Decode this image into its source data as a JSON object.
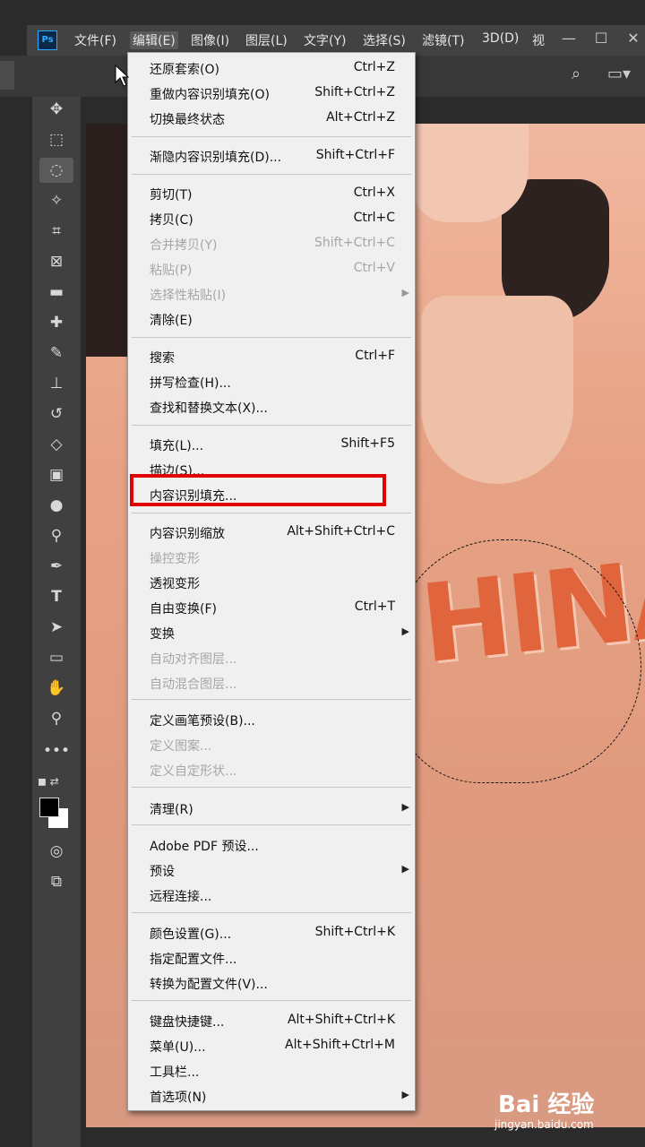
{
  "app": {
    "logo": "Ps"
  },
  "menubar": {
    "items": [
      "文件(F)",
      "编辑(E)",
      "图像(I)",
      "图层(L)",
      "文字(Y)",
      "选择(S)",
      "滤镜(T)",
      "3D(D)",
      "视"
    ],
    "active": "编辑(E)",
    "window_controls": [
      "minimize-icon",
      "maximize-icon",
      "close-icon"
    ]
  },
  "options_bar": {
    "icons": [
      "search-icon",
      "workspace-icon"
    ]
  },
  "toolbar": {
    "tools": [
      "move-icon",
      "marquee-icon",
      "lasso-icon",
      "magic-wand-icon",
      "crop-icon",
      "frame-icon",
      "ruler-icon",
      "healing-icon",
      "brush-icon",
      "stamp-icon",
      "history-brush-icon",
      "eraser-icon",
      "gradient-icon",
      "blur-icon",
      "dodge-icon",
      "pen-icon",
      "type-icon",
      "path-select-icon",
      "rectangle-icon",
      "hand-icon",
      "zoom-icon",
      "more-icon"
    ],
    "selected": "lasso-icon",
    "foreground": "#000000",
    "background": "#ffffff"
  },
  "edit_menu": {
    "items": [
      {
        "label": "还原套索(O)",
        "shortcut": "Ctrl+Z"
      },
      {
        "label": "重做内容识别填充(O)",
        "shortcut": "Shift+Ctrl+Z"
      },
      {
        "label": "切换最终状态",
        "shortcut": "Alt+Ctrl+Z"
      },
      {
        "label": "渐隐内容识别填充(D)...",
        "shortcut": "Shift+Ctrl+F"
      },
      {
        "label": "剪切(T)",
        "shortcut": "Ctrl+X"
      },
      {
        "label": "拷贝(C)",
        "shortcut": "Ctrl+C"
      },
      {
        "label": "合并拷贝(Y)",
        "shortcut": "Shift+Ctrl+C",
        "disabled": true
      },
      {
        "label": "粘贴(P)",
        "shortcut": "Ctrl+V",
        "disabled": true
      },
      {
        "label": "选择性粘贴(I)",
        "shortcut": "",
        "disabled": true,
        "submenu": true
      },
      {
        "label": "清除(E)",
        "shortcut": ""
      },
      {
        "label": "搜索",
        "shortcut": "Ctrl+F"
      },
      {
        "label": "拼写检查(H)...",
        "shortcut": ""
      },
      {
        "label": "查找和替换文本(X)...",
        "shortcut": ""
      },
      {
        "label": "填充(L)...",
        "shortcut": "Shift+F5"
      },
      {
        "label": "描边(S)...",
        "shortcut": ""
      },
      {
        "label": "内容识别填充...",
        "shortcut": "",
        "highlighted": true
      },
      {
        "label": "内容识别缩放",
        "shortcut": "Alt+Shift+Ctrl+C"
      },
      {
        "label": "操控变形",
        "shortcut": "",
        "disabled": true
      },
      {
        "label": "透视变形",
        "shortcut": ""
      },
      {
        "label": "自由变换(F)",
        "shortcut": "Ctrl+T"
      },
      {
        "label": "变换",
        "shortcut": "",
        "submenu": true
      },
      {
        "label": "自动对齐图层...",
        "shortcut": "",
        "disabled": true
      },
      {
        "label": "自动混合图层...",
        "shortcut": "",
        "disabled": true
      },
      {
        "label": "定义画笔预设(B)...",
        "shortcut": ""
      },
      {
        "label": "定义图案...",
        "shortcut": "",
        "disabled": true
      },
      {
        "label": "定义自定形状...",
        "shortcut": "",
        "disabled": true
      },
      {
        "label": "清理(R)",
        "shortcut": "",
        "submenu": true
      },
      {
        "label": "Adobe PDF 预设...",
        "shortcut": ""
      },
      {
        "label": "预设",
        "shortcut": "",
        "submenu": true
      },
      {
        "label": "远程连接...",
        "shortcut": ""
      },
      {
        "label": "颜色设置(G)...",
        "shortcut": "Shift+Ctrl+K"
      },
      {
        "label": "指定配置文件...",
        "shortcut": ""
      },
      {
        "label": "转换为配置文件(V)...",
        "shortcut": ""
      },
      {
        "label": "键盘快捷键...",
        "shortcut": "Alt+Shift+Ctrl+K"
      },
      {
        "label": "菜单(U)...",
        "shortcut": "Alt+Shift+Ctrl+M"
      },
      {
        "label": "工具栏...",
        "shortcut": ""
      },
      {
        "label": "首选项(N)",
        "shortcut": "",
        "submenu": true
      }
    ]
  },
  "canvas": {
    "shirt_text": "HINA"
  },
  "watermark": {
    "brand": "Bai 经验",
    "url": "jingyan.baidu.com"
  },
  "highlight_color": "#e00000"
}
